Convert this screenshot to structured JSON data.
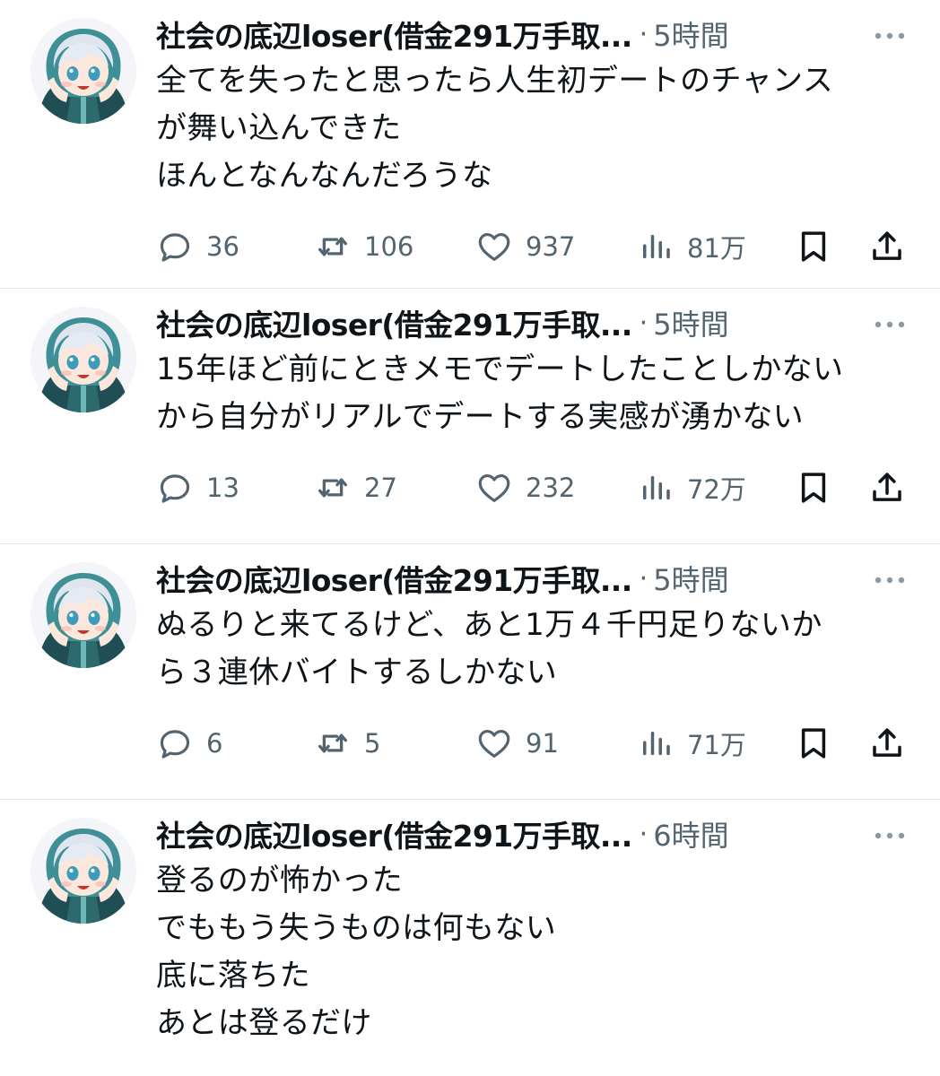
{
  "tweets": [
    {
      "author": "社会の底辺loser(借金291万手取...",
      "time": "5時間",
      "text": "全てを失ったと思ったら人生初デートのチャンス\nが舞い込んできた\nほんとなんなんだろうな",
      "replies": "36",
      "retweets": "106",
      "likes": "937",
      "views": "81万"
    },
    {
      "author": "社会の底辺loser(借金291万手取...",
      "time": "5時間",
      "text": "15年ほど前にときメモでデートしたことしかない\nから自分がリアルでデートする実感が湧かない",
      "replies": "13",
      "retweets": "27",
      "likes": "232",
      "views": "72万"
    },
    {
      "author": "社会の底辺loser(借金291万手取...",
      "time": "5時間",
      "text": "ぬるりと来てるけど、あと1万４千円足りないか\nら３連休バイトするしかない",
      "replies": "6",
      "retweets": "5",
      "likes": "91",
      "views": "71万"
    },
    {
      "author": "社会の底辺loser(借金291万手取...",
      "time": "6時間",
      "text": "登るのが怖かった\nでももう失うものは何もない\n底に落ちた\nあとは登るだけ",
      "replies": "",
      "retweets": "",
      "likes": "",
      "views": ""
    }
  ],
  "separator": "·",
  "icons": {
    "avatar": "anime-character-avatar",
    "more": "more-dots-icon",
    "reply": "reply-bubble-icon",
    "retweet": "retweet-icon",
    "like": "heart-icon",
    "views": "views-bar-chart-icon",
    "bookmark": "bookmark-icon",
    "share": "share-upload-icon"
  },
  "colors": {
    "text": "#0f1419",
    "secondary": "#536471",
    "divider": "#e4e7ea"
  }
}
